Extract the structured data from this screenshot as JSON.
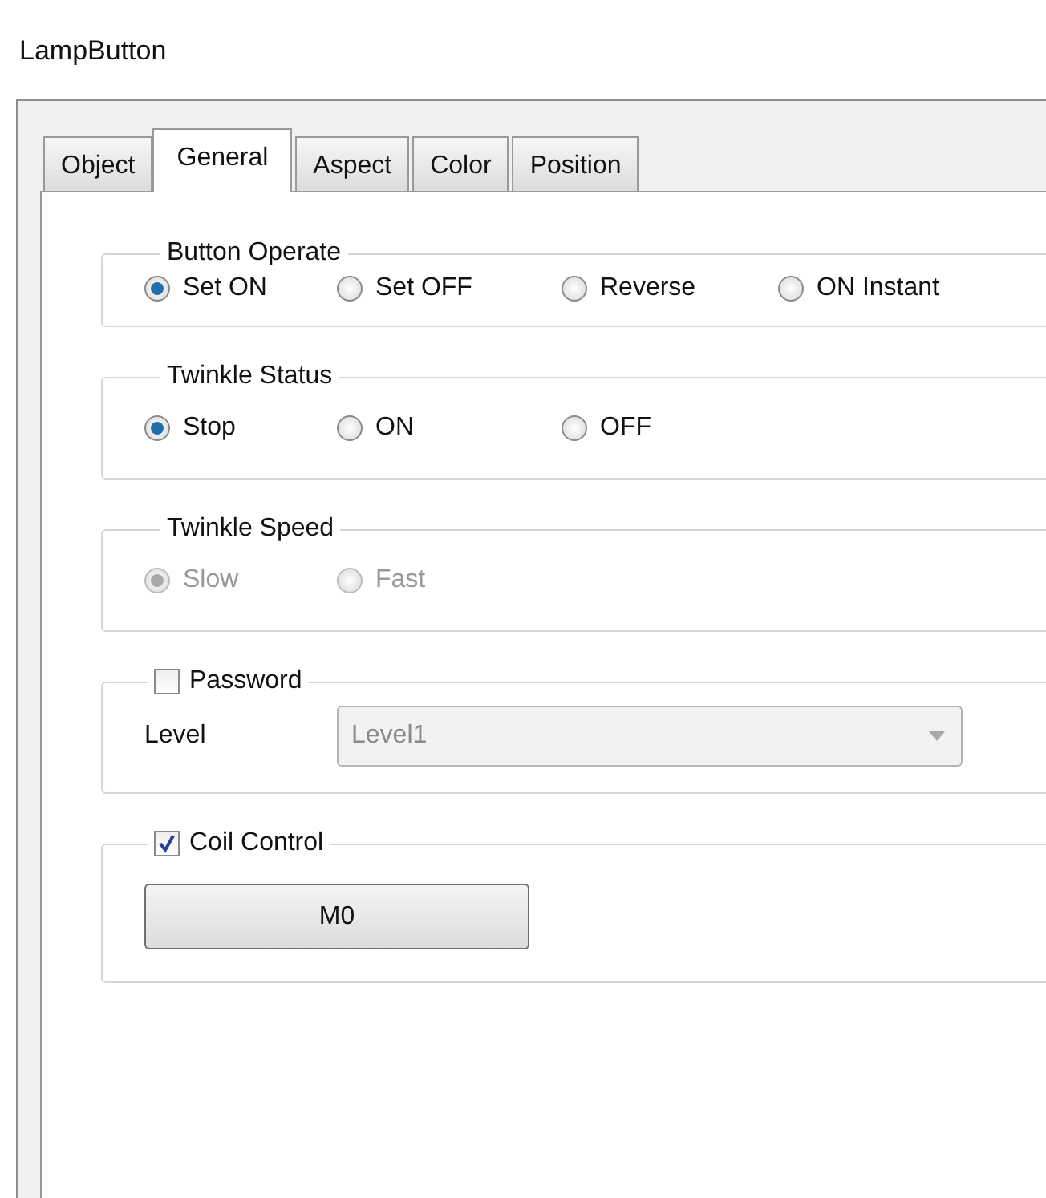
{
  "window": {
    "title": "LampButton"
  },
  "tabs": [
    {
      "label": "Object",
      "selected": false
    },
    {
      "label": "General",
      "selected": true
    },
    {
      "label": "Aspect",
      "selected": false
    },
    {
      "label": "Color",
      "selected": false
    },
    {
      "label": "Position",
      "selected": false
    }
  ],
  "groups": [
    {
      "kind": "radio",
      "title": "Button Operate",
      "disabled": false,
      "options": [
        {
          "label": "Set ON",
          "selected": true
        },
        {
          "label": "Set OFF",
          "selected": false
        },
        {
          "label": "Reverse",
          "selected": false
        },
        {
          "label": "ON Instant",
          "selected": false
        }
      ]
    },
    {
      "kind": "radio",
      "title": "Twinkle Status",
      "disabled": false,
      "options": [
        {
          "label": "Stop",
          "selected": true
        },
        {
          "label": "ON",
          "selected": false
        },
        {
          "label": "OFF",
          "selected": false
        }
      ]
    },
    {
      "kind": "radio",
      "title": "Twinkle Speed",
      "disabled": true,
      "options": [
        {
          "label": "Slow",
          "selected": true
        },
        {
          "label": "Fast",
          "selected": false
        }
      ]
    },
    {
      "kind": "check-dropdown",
      "title": "Password",
      "checked": false,
      "field_label": "Level",
      "value": "Level1",
      "disabled": true
    },
    {
      "kind": "check-button",
      "title": "Coil Control",
      "checked": true,
      "button": "M0"
    }
  ]
}
